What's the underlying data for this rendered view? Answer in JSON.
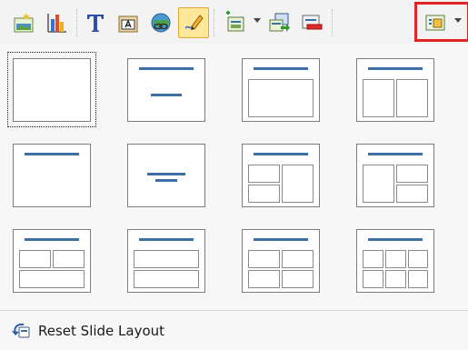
{
  "toolbar": {
    "buttons": [
      {
        "name": "insert-picture-button",
        "icon": "picture-icon"
      },
      {
        "name": "insert-chart-button",
        "icon": "bar-chart-icon"
      },
      {
        "name": "text-button",
        "icon": "text-t-icon"
      },
      {
        "name": "insert-textbox-button",
        "icon": "textbox-icon"
      },
      {
        "name": "insert-hyperlink-button",
        "icon": "hyperlink-icon"
      },
      {
        "name": "drawing-tool-button",
        "icon": "pencil-icon",
        "active": true
      },
      {
        "name": "new-slide-button",
        "icon": "new-slide-icon"
      },
      {
        "name": "duplicate-slide-button",
        "icon": "duplicate-slide-icon"
      },
      {
        "name": "delete-slide-button",
        "icon": "delete-slide-icon"
      },
      {
        "name": "slide-layout-button",
        "icon": "slide-layout-icon",
        "highlighted": true
      }
    ],
    "highlight_color": "#e02626"
  },
  "layouts": [
    {
      "name": "blank",
      "selected": true
    },
    {
      "name": "title-content"
    },
    {
      "name": "title-content-box"
    },
    {
      "name": "title-two-columns"
    },
    {
      "name": "title-only"
    },
    {
      "name": "centered-text"
    },
    {
      "name": "title-two-left-one-right"
    },
    {
      "name": "title-one-left-two-right"
    },
    {
      "name": "title-two-top-one-bottom"
    },
    {
      "name": "title-one-top-two-bottom"
    },
    {
      "name": "title-four-boxes"
    },
    {
      "name": "title-six-boxes"
    }
  ],
  "reset": {
    "label": "Reset Slide Layout",
    "icon": "undo-arrow-icon"
  },
  "colors": {
    "accent_bar": "#3b6fa6",
    "active_button": "#ffe89a"
  }
}
